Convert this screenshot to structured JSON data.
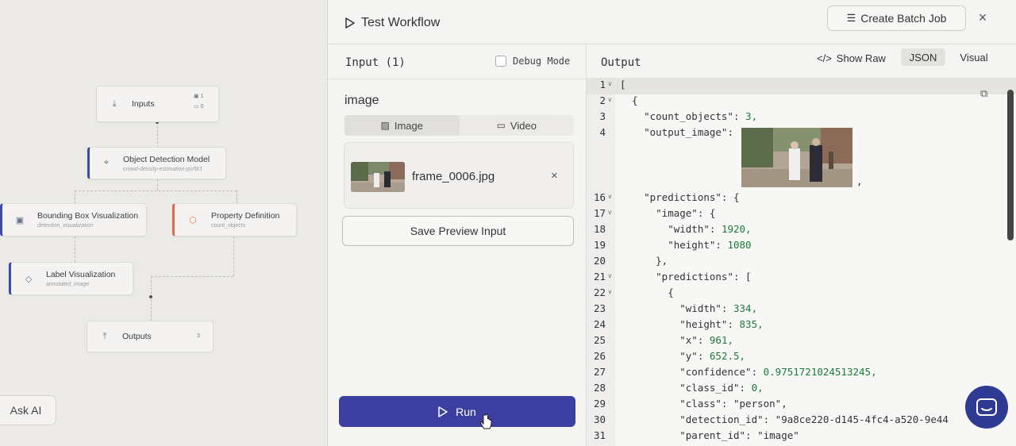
{
  "canvas": {
    "nodes": {
      "inputs": {
        "title": "Inputs",
        "badge_top": "1",
        "badge_bottom": "0"
      },
      "detection": {
        "title": "Object Detection Model",
        "subtitle": "crowd-density-estimation-pjv5l/1"
      },
      "bbox_viz": {
        "title": "Bounding Box Visualization",
        "subtitle": "detection_visualization"
      },
      "property_def": {
        "title": "Property Definition",
        "subtitle": "count_objects"
      },
      "label_viz": {
        "title": "Label Visualization",
        "subtitle": "annotated_image"
      },
      "outputs": {
        "title": "Outputs",
        "badge": "3"
      }
    },
    "ask_ai": "Ask AI"
  },
  "modal": {
    "title": "Test Workflow",
    "batch_button": "Create Batch Job",
    "close": "×"
  },
  "input": {
    "header": "Input (1)",
    "debug_mode": "Debug Mode",
    "field_name": "image",
    "tabs": [
      "Image",
      "Video"
    ],
    "file_name": "frame_0006.jpg",
    "remove": "×",
    "save_preview": "Save Preview Input",
    "run": "Run"
  },
  "output": {
    "header": "Output",
    "show_raw": "Show Raw",
    "json_tab": "JSON",
    "visual_tab": "Visual",
    "lines": [
      {
        "n": "1",
        "fold": true,
        "text": "["
      },
      {
        "n": "2",
        "fold": true,
        "text": "  {"
      },
      {
        "n": "3",
        "fold": false,
        "text": "    \"count_objects\": 3,"
      },
      {
        "n": "4",
        "fold": false,
        "text": "    \"output_image\": "
      },
      {
        "n": "16",
        "fold": true,
        "text": "    \"predictions\": {"
      },
      {
        "n": "17",
        "fold": true,
        "text": "      \"image\": {"
      },
      {
        "n": "18",
        "fold": false,
        "text": "        \"width\": 1920,"
      },
      {
        "n": "19",
        "fold": false,
        "text": "        \"height\": 1080"
      },
      {
        "n": "20",
        "fold": false,
        "text": "      },"
      },
      {
        "n": "21",
        "fold": true,
        "text": "      \"predictions\": ["
      },
      {
        "n": "22",
        "fold": true,
        "text": "        {"
      },
      {
        "n": "23",
        "fold": false,
        "text": "          \"width\": 334,"
      },
      {
        "n": "24",
        "fold": false,
        "text": "          \"height\": 835,"
      },
      {
        "n": "25",
        "fold": false,
        "text": "          \"x\": 961,"
      },
      {
        "n": "26",
        "fold": false,
        "text": "          \"y\": 652.5,"
      },
      {
        "n": "27",
        "fold": false,
        "text": "          \"confidence\": 0.9751721024513245,"
      },
      {
        "n": "28",
        "fold": false,
        "text": "          \"class_id\": 0,"
      },
      {
        "n": "29",
        "fold": false,
        "text": "          \"class\": \"person\","
      },
      {
        "n": "30",
        "fold": false,
        "text": "          \"detection_id\": \"9a8ce220-d145-4fc4-a520-9e44"
      },
      {
        "n": "31",
        "fold": false,
        "text": "          \"parent_id\": \"image\""
      }
    ],
    "image_comma": ","
  },
  "colors": {
    "accent": "#3c3fa0",
    "fab": "#2f3a93"
  }
}
